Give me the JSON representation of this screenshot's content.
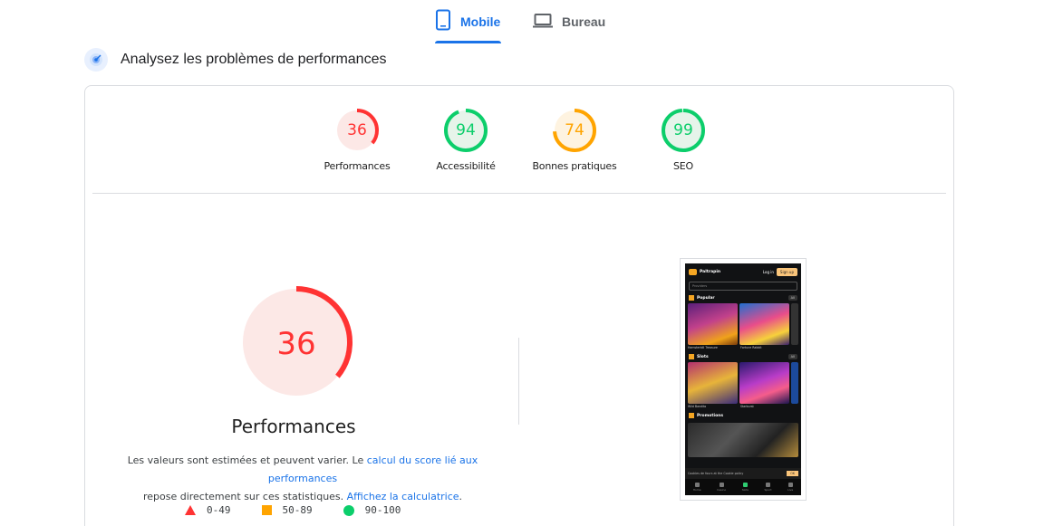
{
  "tabs": [
    {
      "label": "Mobile",
      "icon": "phone-icon",
      "active": true
    },
    {
      "label": "Bureau",
      "icon": "laptop-icon",
      "active": false
    }
  ],
  "heading": {
    "text": "Analysez les problèmes de performances",
    "icon": "lighthouse-icon"
  },
  "scores": [
    {
      "value": "36",
      "label": "Performances",
      "color": "#ff3333",
      "bg": "#fce8e6",
      "fraction": 0.36
    },
    {
      "value": "94",
      "label": "Accessibilité",
      "color": "#0cce6b",
      "bg": "#e6f4ea",
      "fraction": 0.94
    },
    {
      "value": "74",
      "label": "Bonnes pratiques",
      "color": "#ffa400",
      "bg": "#fef3e0",
      "fraction": 0.74
    },
    {
      "value": "99",
      "label": "SEO",
      "color": "#0cce6b",
      "bg": "#e6f4ea",
      "fraction": 0.99
    }
  ],
  "main_score": {
    "value": "36",
    "title": "Performances",
    "color": "#ff3333",
    "bg": "#fce8e6",
    "fraction": 0.36
  },
  "description": {
    "part1": "Les valeurs sont estimées et peuvent varier. Le ",
    "link1": "calcul du score lié aux performances",
    "part2": " repose directement sur ces statistiques. ",
    "link2": "Affichez la calculatrice",
    "part3": "."
  },
  "legend": [
    {
      "range": "0-49",
      "shape": "triangle",
      "color": "#ff3333"
    },
    {
      "range": "50-89",
      "shape": "square",
      "color": "#ffa400"
    },
    {
      "range": "90-100",
      "shape": "circle",
      "color": "#0cce6b"
    }
  ],
  "phone": {
    "brand": "Paltrapin",
    "login": "Log in",
    "signup": "Sign up",
    "search": "Providers",
    "sections": [
      "Popular",
      "Slots",
      "Promotions"
    ],
    "all": "All",
    "popular_games": [
      "Hamsterbill Treasure",
      "Fortune Rabbit"
    ],
    "slots_games": [
      "Wild Bandito",
      "Starburst"
    ],
    "cookie": "Cookies de fours at the Cookie policy",
    "cookie_ok": "OK",
    "nav": [
      "Home",
      "Casino",
      "Slots",
      "Sport",
      "Live"
    ]
  }
}
